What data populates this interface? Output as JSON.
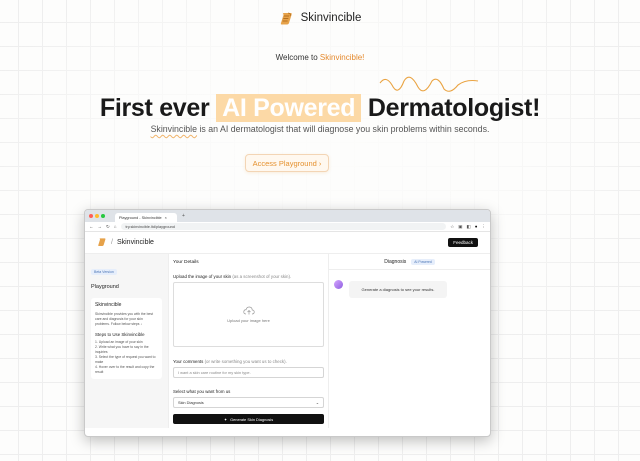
{
  "brand": {
    "name": "Skinvincible"
  },
  "hero": {
    "welcome_prefix": "Welcome to ",
    "welcome_brand": "Skinvincible!",
    "title_pre": "First ever ",
    "title_highlight": "AI Powered",
    "title_post": " Dermatologist!",
    "subtitle_brand": "Skinvincible",
    "subtitle_rest": " is an AI dermatologist that will diagnose you skin problems within seconds.",
    "cta_label": "Access Playground ›"
  },
  "colors": {
    "accent": "#e58a2e",
    "highlight_bg": "#fcd9a6",
    "dark": "#111111"
  },
  "browser": {
    "tab_title": "Playground - Skinvincible",
    "url": "try.skinvincible.ltd/playground"
  },
  "app": {
    "header_sep": "/",
    "header_title": "Skinvincible",
    "feedback_label": "Feedback",
    "sidebar": {
      "badge": "Beta Version",
      "heading": "Playground",
      "card_title": "Skinvincible",
      "card_desc": "Skinvincible provides you with the best care and diagnosis for your skin problems. Follow below steps ↓",
      "steps_title": "Steps to Use Skinvincible",
      "steps": [
        "1. Upload an image of your skin",
        "2. Write what you have to say in the inquiries",
        "3. Select the type of request you want to make",
        "4. Hover over to the result and copy the result"
      ]
    },
    "details": {
      "heading": "Your Details",
      "upload_label": "Upload the image of your skin",
      "upload_hint": " (as a screenshot of your skin).",
      "upload_text": "Upload your image here",
      "comments_label": "Your comments",
      "comments_hint": " (or write something you want us to check).",
      "comments_placeholder": "I want a skin care routine for my skin type.",
      "select_label": "Select what you want from us",
      "select_value": "Skin Diagnosis",
      "generate_label": "Generate Skin Diagnosis"
    },
    "diagnosis": {
      "heading": "Diagnosis",
      "badge": "AI Powered",
      "message": "Generate a diagnosis to see your results."
    }
  }
}
